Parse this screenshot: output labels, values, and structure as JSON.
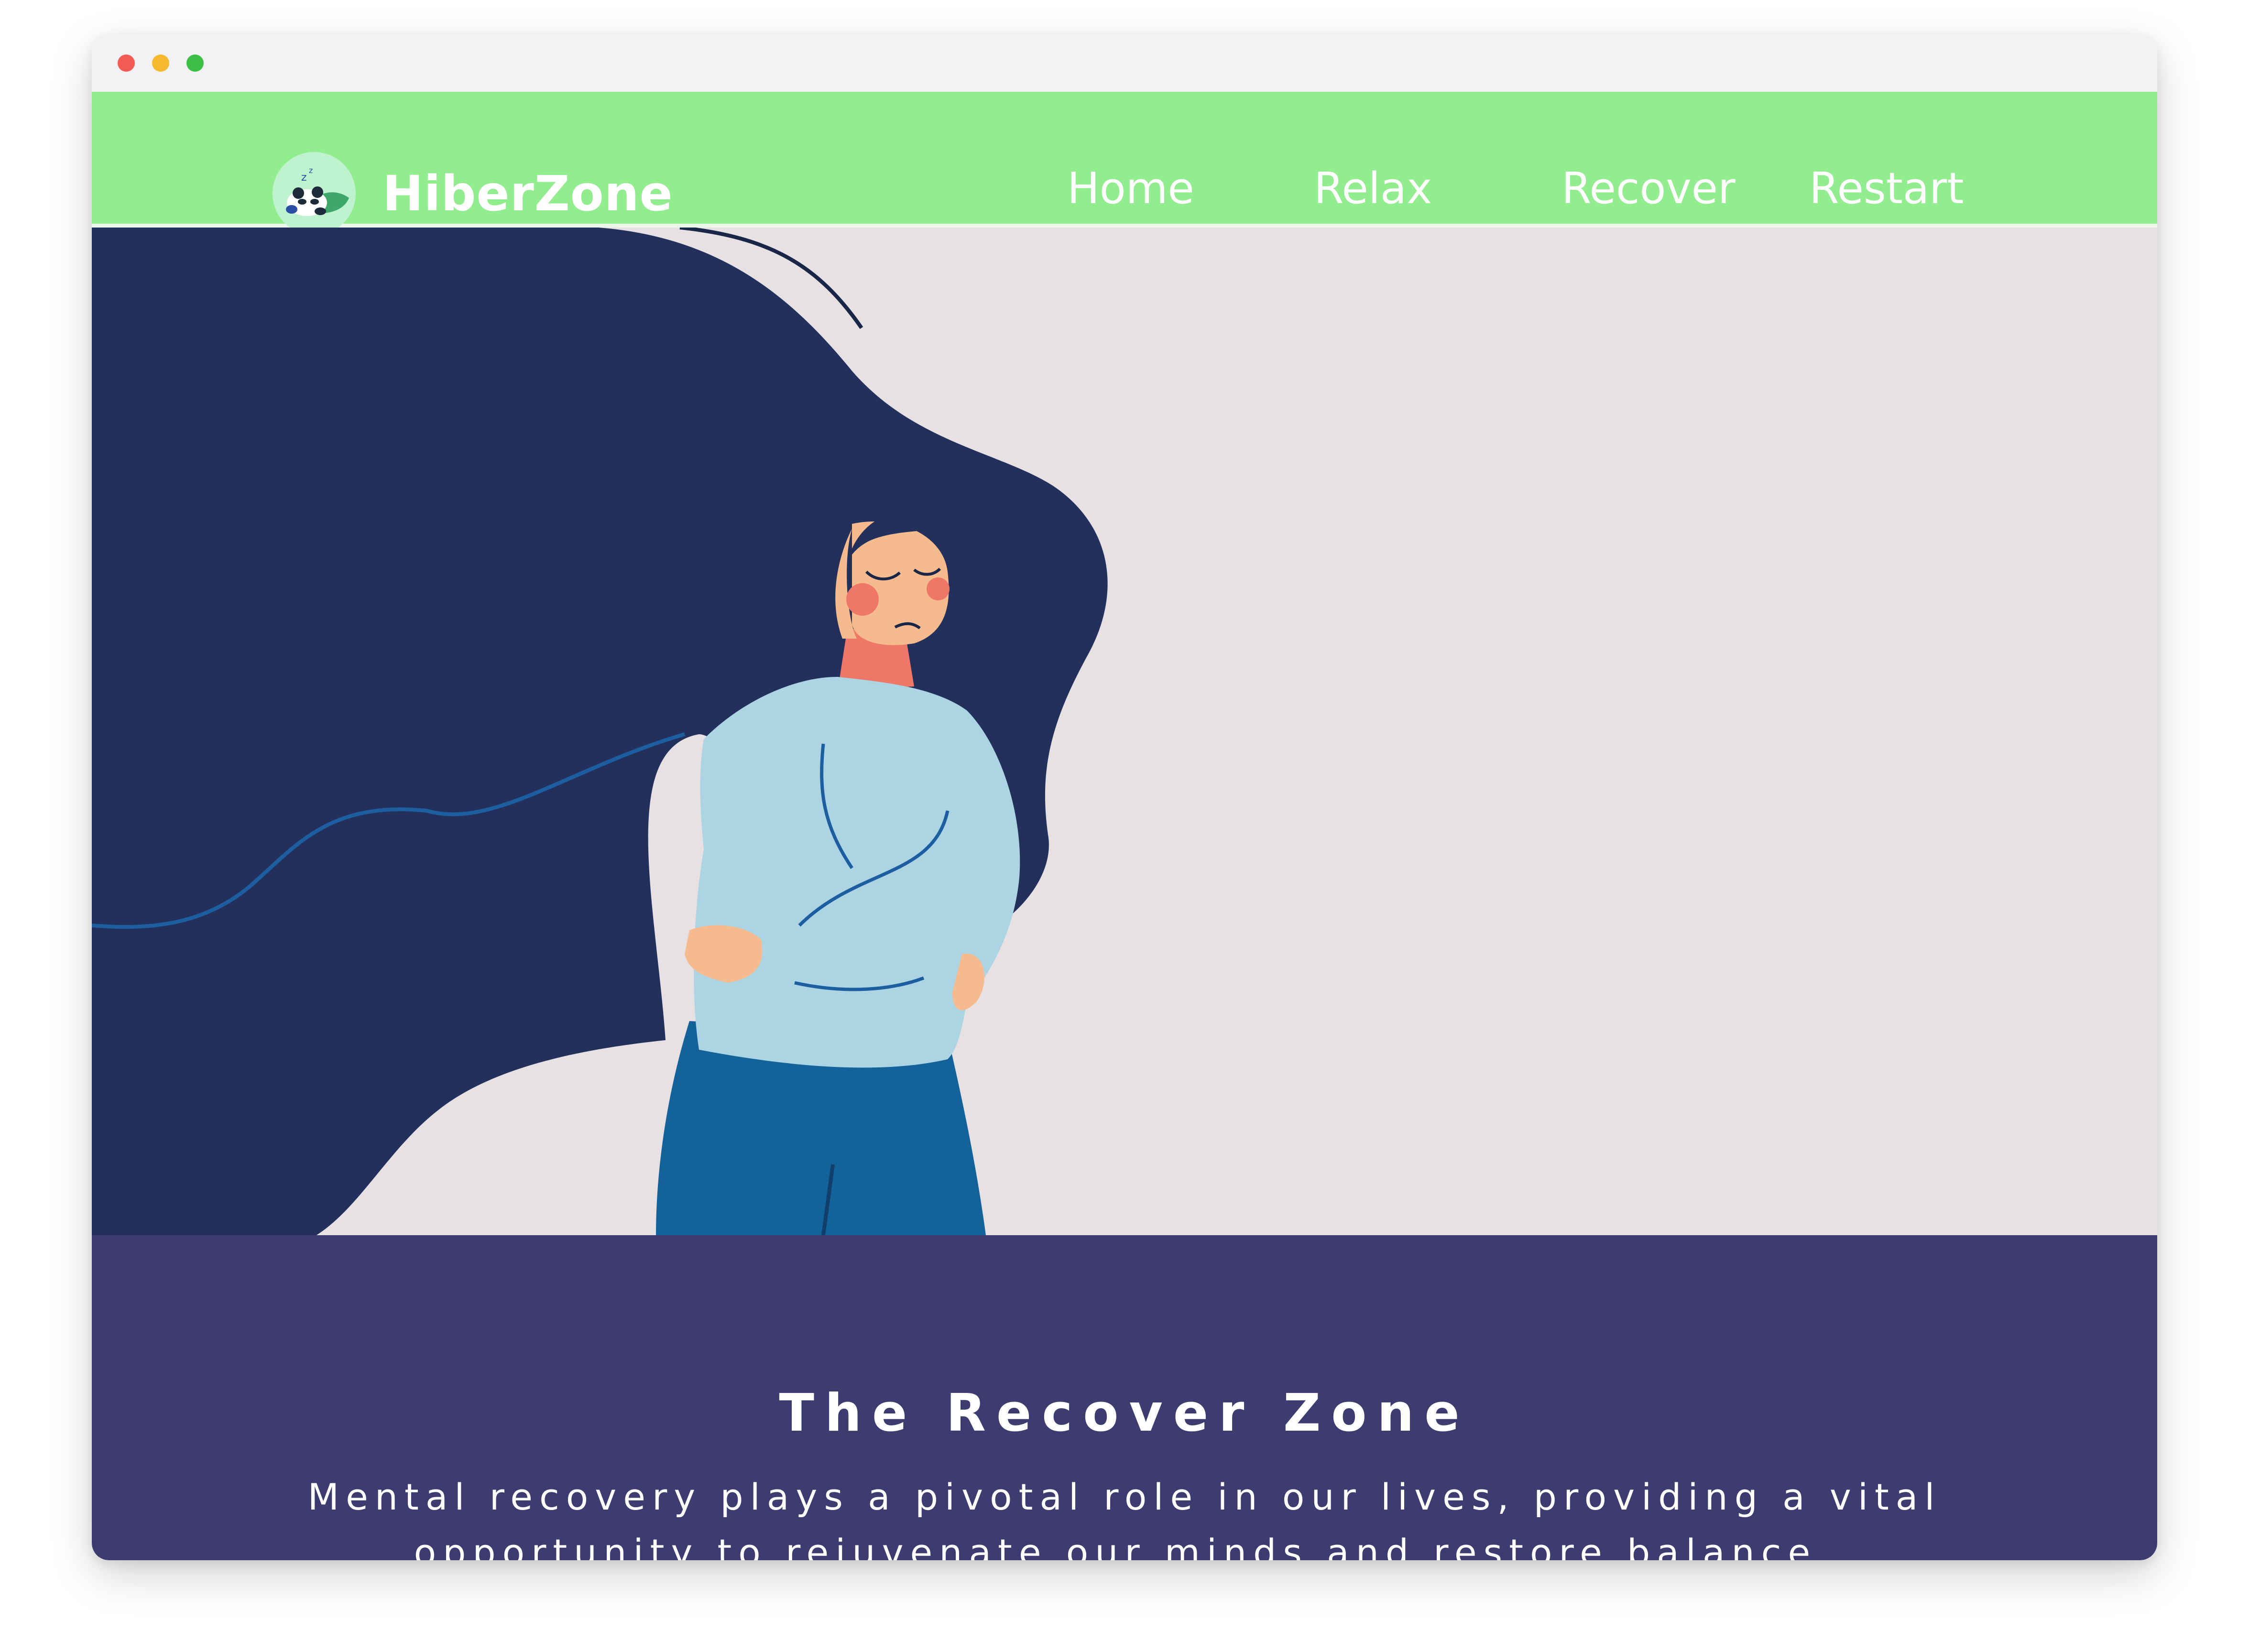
{
  "browser": {
    "controls": [
      "close",
      "minimize",
      "maximize"
    ]
  },
  "navbar": {
    "brand": "HiberZone",
    "logo_icon": "sleeping-panda-icon",
    "links": [
      {
        "label": "Home"
      },
      {
        "label": "Relax"
      },
      {
        "label": "Recover"
      },
      {
        "label": "Restart"
      }
    ]
  },
  "hero": {
    "illustration": "woman-hugging-self-with-flowing-hair"
  },
  "section": {
    "title": "The Recover Zone",
    "body": "Mental recovery plays a pivotal role in our lives, providing a vital opportunity to rejuvenate our minds and restore balance. Embracing"
  },
  "colors": {
    "navbar": "#92ed8f",
    "hero_bg": "#e7e1e4",
    "section_bg": "#3d3b70",
    "hair": "#22305b",
    "sweater": "#acd4e3",
    "pants": "#14629a"
  }
}
